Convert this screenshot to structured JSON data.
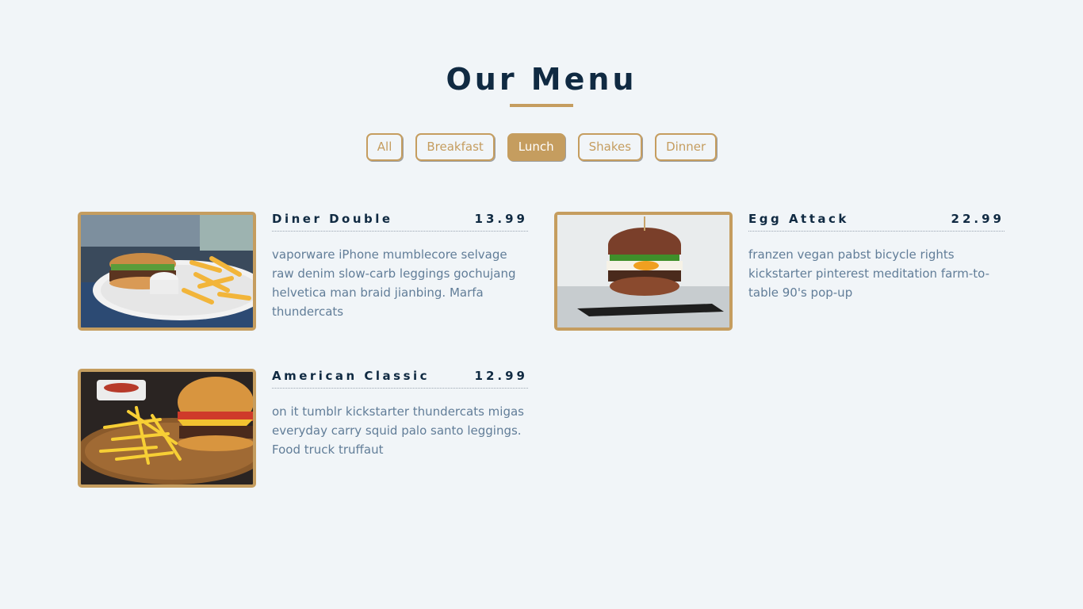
{
  "header": {
    "title": "Our Menu"
  },
  "filters": {
    "items": [
      {
        "label": "All",
        "active": false
      },
      {
        "label": "Breakfast",
        "active": false
      },
      {
        "label": "Lunch",
        "active": true
      },
      {
        "label": "Shakes",
        "active": false
      },
      {
        "label": "Dinner",
        "active": false
      }
    ]
  },
  "colors": {
    "accent": "#c59d5f",
    "heading": "#102a42",
    "body_text": "#617d98",
    "background": "#f1f5f8"
  },
  "menu": {
    "items": [
      {
        "name": "Diner Double",
        "price": "13.99",
        "description": "vaporware iPhone mumblecore selvage raw denim slow-carb leggings gochujang helvetica man braid jianbing. Marfa thundercats"
      },
      {
        "name": "Egg Attack",
        "price": "22.99",
        "description": "franzen vegan pabst bicycle rights kickstarter pinterest meditation farm-to-table 90's pop-up"
      },
      {
        "name": "American Classic",
        "price": "12.99",
        "description": "on it tumblr kickstarter thundercats migas everyday carry squid palo santo leggings. Food truck truffaut"
      }
    ]
  }
}
